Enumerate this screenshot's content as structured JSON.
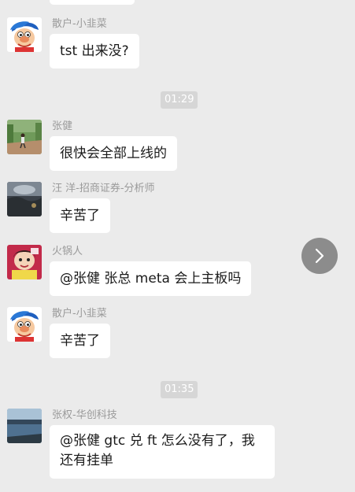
{
  "messages": [
    {
      "sender": "散户-小韭菜",
      "text": "tst 出来没?",
      "avatar": "cartoon-boy-avatar"
    },
    {
      "sender": "张健",
      "text": "很快会全部上线的",
      "avatar": "runner-photo-avatar"
    },
    {
      "sender": "汪 洋-招商证券-分析师",
      "text": "辛苦了",
      "avatar": "landscape-photo-avatar"
    },
    {
      "sender": "火锅人",
      "text": "@张健  张总 meta 会上主板吗",
      "avatar": "cartoon-girl-avatar"
    },
    {
      "sender": "散户-小韭菜",
      "text": "辛苦了",
      "avatar": "cartoon-boy-avatar"
    },
    {
      "sender": "张权-华创科技",
      "text": "@张健  gtc 兑 ft 怎么没有了，我还有挂单",
      "avatar": "lake-photo-avatar"
    }
  ],
  "timestamps": [
    "01:29",
    "01:35"
  ],
  "scroll_button": {
    "icon": "chevron-right-icon"
  },
  "colors": {
    "background": "#ebebeb",
    "bubble": "#ffffff",
    "timestamp_bg": "#d6d6d6",
    "sender_text": "#9a9a9a"
  }
}
